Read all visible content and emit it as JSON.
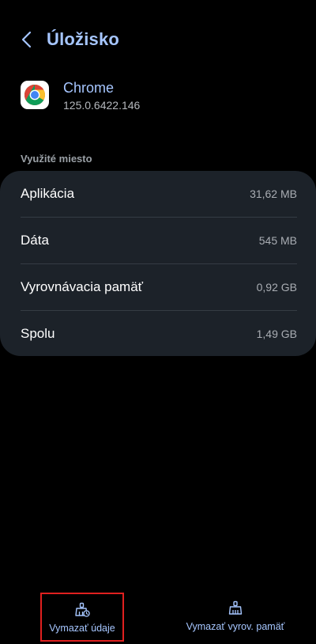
{
  "header": {
    "title": "Úložisko"
  },
  "app": {
    "name": "Chrome",
    "version": "125.0.6422.146"
  },
  "usage": {
    "section_label": "Využité miesto",
    "rows": [
      {
        "label": "Aplikácia",
        "value": "31,62 MB"
      },
      {
        "label": "Dáta",
        "value": "545 MB"
      },
      {
        "label": "Vyrovnávacia pamäť",
        "value": "0,92 GB"
      },
      {
        "label": "Spolu",
        "value": "1,49 GB"
      }
    ]
  },
  "actions": {
    "clear_data_label": "Vymazať údaje",
    "clear_cache_label": "Vymazať vyrov. pamäť"
  },
  "colors": {
    "accent": "#a6c6ff",
    "card_bg": "#1c2229",
    "highlight_border": "#e0201f"
  },
  "icons": {
    "back": "chevron-left-icon",
    "app": "chrome-logo-icon",
    "clear_data": "broom-clear-data-icon",
    "clear_cache": "broom-clear-cache-icon"
  }
}
